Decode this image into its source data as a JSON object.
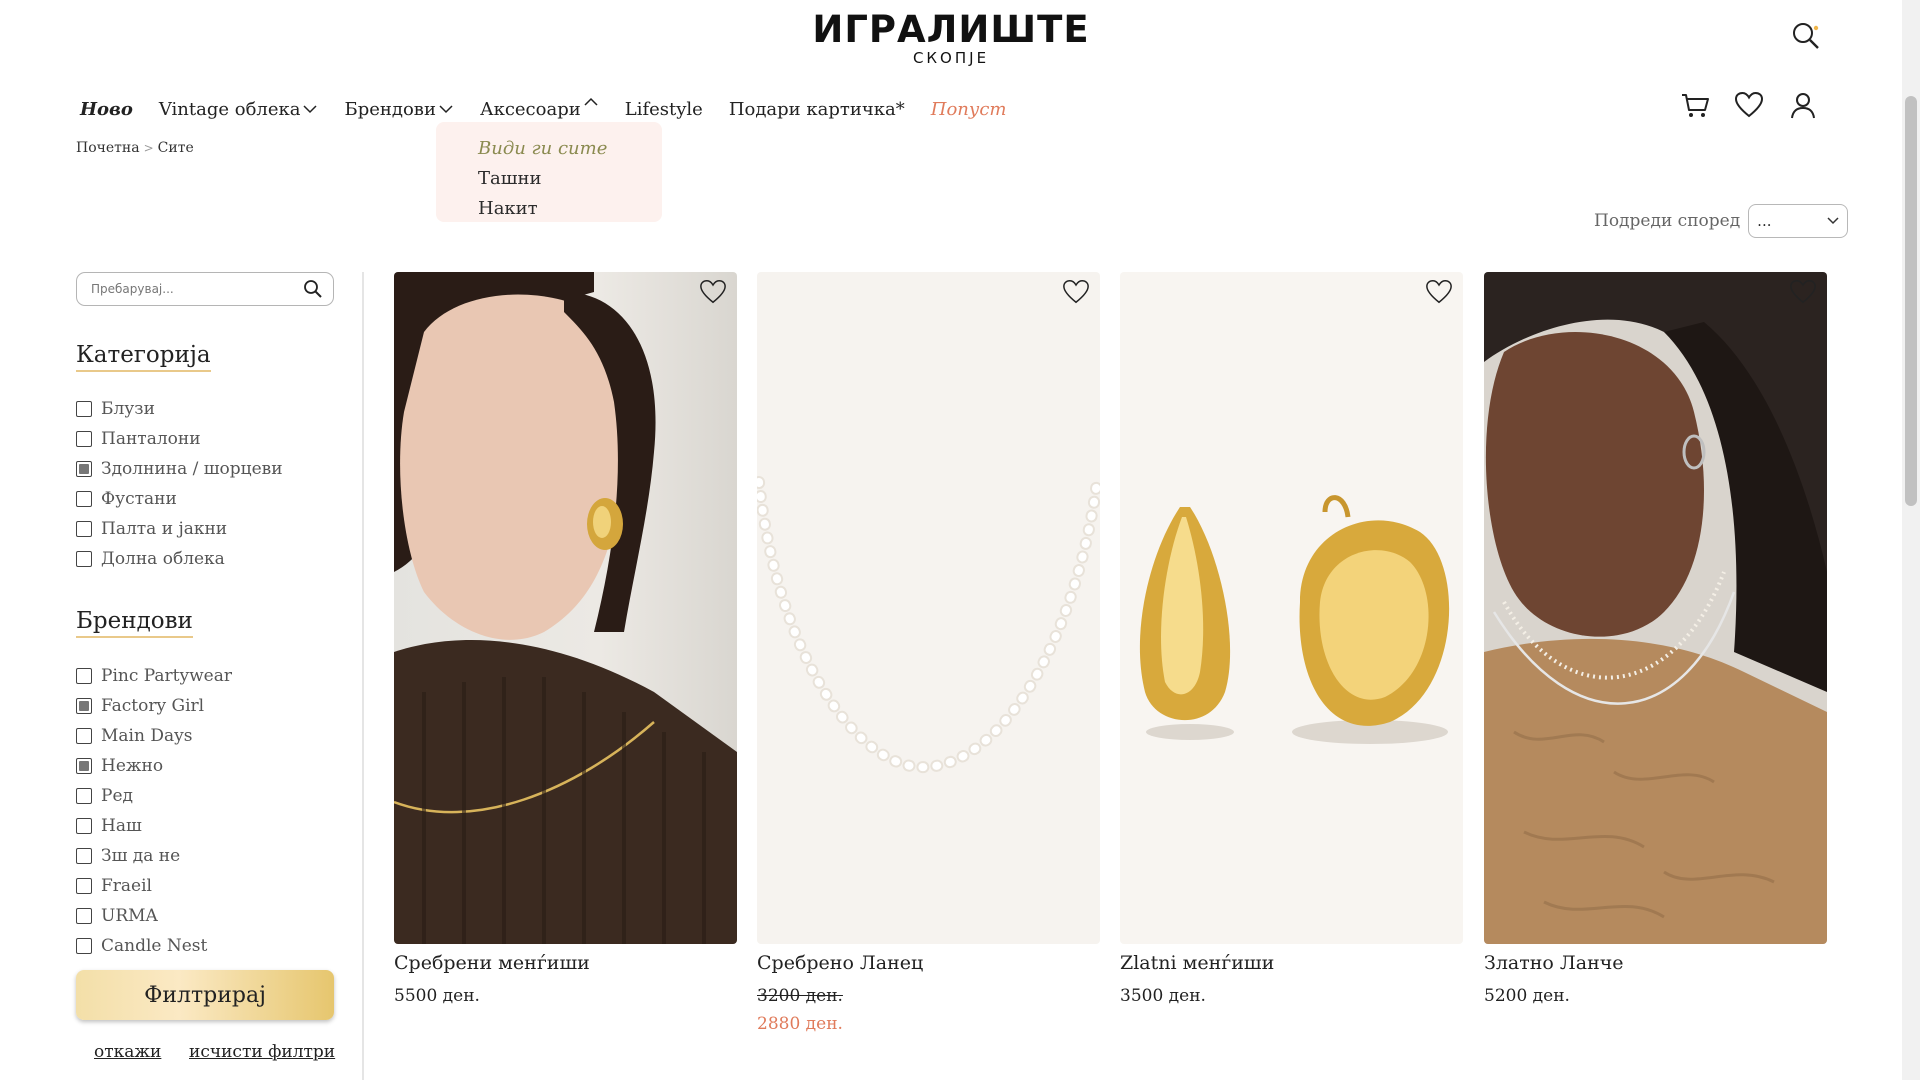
{
  "logo": {
    "main": "ИГРАЛИШТЕ",
    "sub": "СКОПЈЕ"
  },
  "nav": {
    "items": [
      {
        "label": "Ново"
      },
      {
        "label": "Vintage облека"
      },
      {
        "label": "Брендови"
      },
      {
        "label": "Аксесоари"
      },
      {
        "label": "Lifestyle"
      },
      {
        "label": "Подари картичка*"
      },
      {
        "label": "Попуст"
      }
    ],
    "dropdown": [
      "Види ги сите",
      "Ташни",
      "Накит"
    ]
  },
  "breadcrumb": {
    "home": "Почетна",
    "separator": ">",
    "current": "Сите"
  },
  "sort": {
    "label": "Подреди според",
    "value": "..."
  },
  "search": {
    "placeholder": "Пребарувај..."
  },
  "categories": {
    "title": "Категорија",
    "items": [
      {
        "label": "Блузи",
        "checked": false
      },
      {
        "label": "Панталони",
        "checked": false
      },
      {
        "label": "Здолнина / шорцеви",
        "checked": true
      },
      {
        "label": "Фустани",
        "checked": false
      },
      {
        "label": "Палта и јакни",
        "checked": false
      },
      {
        "label": "Долна облека",
        "checked": false
      }
    ]
  },
  "brands": {
    "title": "Брендови",
    "items": [
      {
        "label": "Pinc Partywear",
        "checked": false
      },
      {
        "label": "Factory Girl",
        "checked": true
      },
      {
        "label": "Main Days",
        "checked": false
      },
      {
        "label": "Нежно",
        "checked": true
      },
      {
        "label": "Ред",
        "checked": false
      },
      {
        "label": "Наш",
        "checked": false
      },
      {
        "label": "Зш да не",
        "checked": false
      },
      {
        "label": "Fraeil",
        "checked": false
      },
      {
        "label": "URMA",
        "checked": false
      },
      {
        "label": "Candle Nest",
        "checked": false
      }
    ]
  },
  "actions": {
    "filter": "Филтрирај",
    "cancel": "откажи",
    "clear": "исчисти филтри"
  },
  "products": [
    {
      "name": "Сребрени менѓиши",
      "price": "5500 ден.",
      "old_price": "",
      "sale_price": ""
    },
    {
      "name": "Сребрено Ланец",
      "price": "",
      "old_price": "3200 ден.",
      "sale_price": "2880 ден."
    },
    {
      "name": "Zlatni менѓиши",
      "price": "3500 ден.",
      "old_price": "",
      "sale_price": ""
    },
    {
      "name": "Златно Ланче",
      "price": "5200 ден.",
      "old_price": "",
      "sale_price": ""
    }
  ],
  "colors": {
    "accent": "#e07b5b",
    "dropdown_bg": "#fdf1ee",
    "gold": "#e6c66e"
  },
  "icons": [
    "search-icon",
    "cart-icon",
    "heart-icon",
    "user-icon",
    "chevron-down-icon",
    "chevron-up-icon"
  ]
}
